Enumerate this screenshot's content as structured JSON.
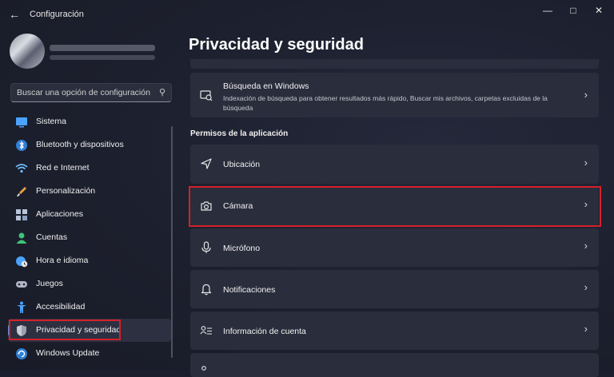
{
  "window": {
    "title": "Configuración",
    "back_icon": "arrow-left-icon",
    "controls": [
      "minimize-icon",
      "maximize-icon",
      "close-icon"
    ]
  },
  "search": {
    "placeholder": "Buscar una opción de configuración",
    "icon": "search-icon"
  },
  "sidebar": {
    "items": [
      {
        "label": "Sistema",
        "icon": "system-icon",
        "color": "#4aa3ff"
      },
      {
        "label": "Bluetooth y dispositivos",
        "icon": "bluetooth-icon",
        "color": "#3a8ee6"
      },
      {
        "label": "Red e Internet",
        "icon": "wifi-icon",
        "color": "#6ec0ff"
      },
      {
        "label": "Personalización",
        "icon": "brush-icon",
        "color": "#e8a040"
      },
      {
        "label": "Aplicaciones",
        "icon": "apps-icon",
        "color": "#b8c4d8"
      },
      {
        "label": "Cuentas",
        "icon": "account-icon",
        "color": "#3ec47a"
      },
      {
        "label": "Hora e idioma",
        "icon": "globe-clock-icon",
        "color": "#4aa3ff"
      },
      {
        "label": "Juegos",
        "icon": "gamepad-icon",
        "color": "#b0b6c4"
      },
      {
        "label": "Accesibilidad",
        "icon": "accessibility-icon",
        "color": "#4aa3ff"
      },
      {
        "label": "Privacidad y seguridad",
        "icon": "shield-icon",
        "color": "#9aa0ac",
        "active": true
      },
      {
        "label": "Windows Update",
        "icon": "update-icon",
        "color": "#3a8ee6"
      }
    ]
  },
  "main": {
    "title": "Privacidad y seguridad",
    "search_card": {
      "title": "Búsqueda en Windows",
      "description": "Indexación de búsqueda para obtener resultados más rápido, Buscar mis archivos, carpetas excluidas de la búsqueda",
      "icon": "search-windows-icon"
    },
    "section_label": "Permisos de la aplicación",
    "permissions": [
      {
        "label": "Ubicación",
        "icon": "location-icon"
      },
      {
        "label": "Cámara",
        "icon": "camera-icon",
        "highlighted": true
      },
      {
        "label": "Micrófono",
        "icon": "microphone-icon"
      },
      {
        "label": "Notificaciones",
        "icon": "bell-icon"
      },
      {
        "label": "Información de cuenta",
        "icon": "account-info-icon"
      }
    ]
  },
  "colors": {
    "highlight": "#d6202a",
    "accent": "#5aa0e6",
    "card": "#2a2d3c",
    "background": "#1b1e2c"
  }
}
